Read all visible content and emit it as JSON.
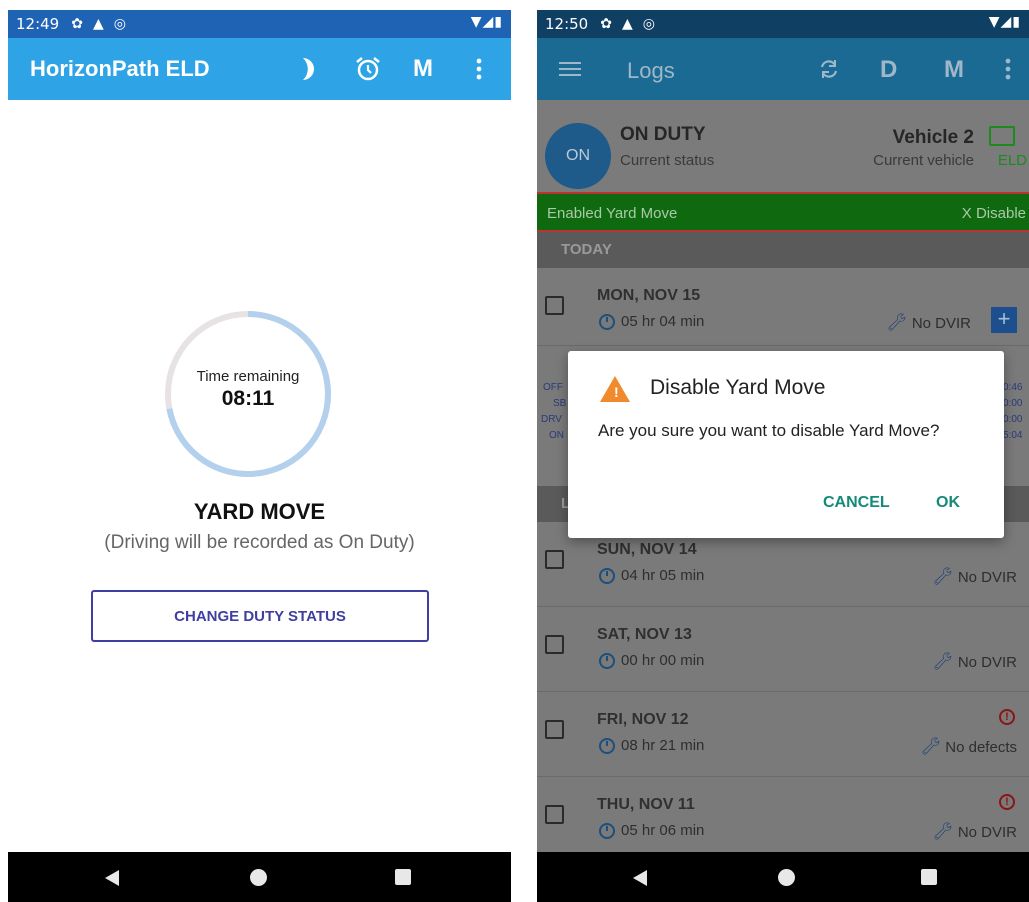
{
  "left_screen": {
    "status_bar": {
      "time": "12:49"
    },
    "app_bar": {
      "title": "HorizonPath ELD",
      "icons": [
        "moon-icon",
        "alarm-clock-icon",
        "m-menu",
        "overflow-menu-icon"
      ],
      "m_label": "M"
    },
    "timer": {
      "label": "Time remaining",
      "value": "08:11",
      "progress_fraction": 0.72
    },
    "status_title": "YARD MOVE",
    "status_subtitle": "(Driving will be recorded as On Duty)",
    "change_button": "CHANGE DUTY STATUS"
  },
  "right_screen": {
    "status_bar": {
      "time": "12:50"
    },
    "app_bar": {
      "title": "Logs",
      "d_label": "D",
      "m_label": "M"
    },
    "current_status": {
      "badge": "ON",
      "title": "ON DUTY",
      "subtitle": "Current status"
    },
    "current_vehicle": {
      "title": "Vehicle 2",
      "subtitle": "Current vehicle",
      "eld_label": "ELD"
    },
    "yard_banner": {
      "text": "Enabled Yard Move",
      "action": "X Disable"
    },
    "sections": {
      "today": "TODAY",
      "previous_initial": "L"
    },
    "logs": [
      {
        "date": "MON, NOV 15",
        "hours": "05 hr  04 min",
        "dvir": "No DVIR",
        "alert": false,
        "plus": true
      },
      {
        "date": "SUN, NOV 14",
        "hours": "04 hr  05 min",
        "dvir": "No DVIR",
        "alert": false
      },
      {
        "date": "SAT, NOV 13",
        "hours": "00 hr  00 min",
        "dvir": "No DVIR",
        "alert": false
      },
      {
        "date": "FRI, NOV 12",
        "hours": "08 hr  21 min",
        "dvir": "No defects",
        "alert": true
      },
      {
        "date": "THU, NOV 11",
        "hours": "05 hr  06 min",
        "dvir": "No DVIR",
        "alert": true
      }
    ],
    "hidden_chart_labels": {
      "left": [
        "OFF",
        "SB",
        "DRV",
        "ON"
      ],
      "right": [
        "0:46",
        "0:00",
        "0:00",
        "5:04"
      ]
    },
    "dialog": {
      "title": "Disable Yard Move",
      "message": "Are you sure you want to disable Yard Move?",
      "cancel": "CANCEL",
      "ok": "OK"
    }
  },
  "colors": {
    "left_app_bar": "#2ea3e6",
    "left_status_bar": "#1f63b4",
    "timer_ring": "#b3d0ec",
    "button_outline": "#3f3fa2",
    "dialog_button": "#168a78",
    "warning": "#f08a2c",
    "yard_banner": "#0f6a0f"
  }
}
